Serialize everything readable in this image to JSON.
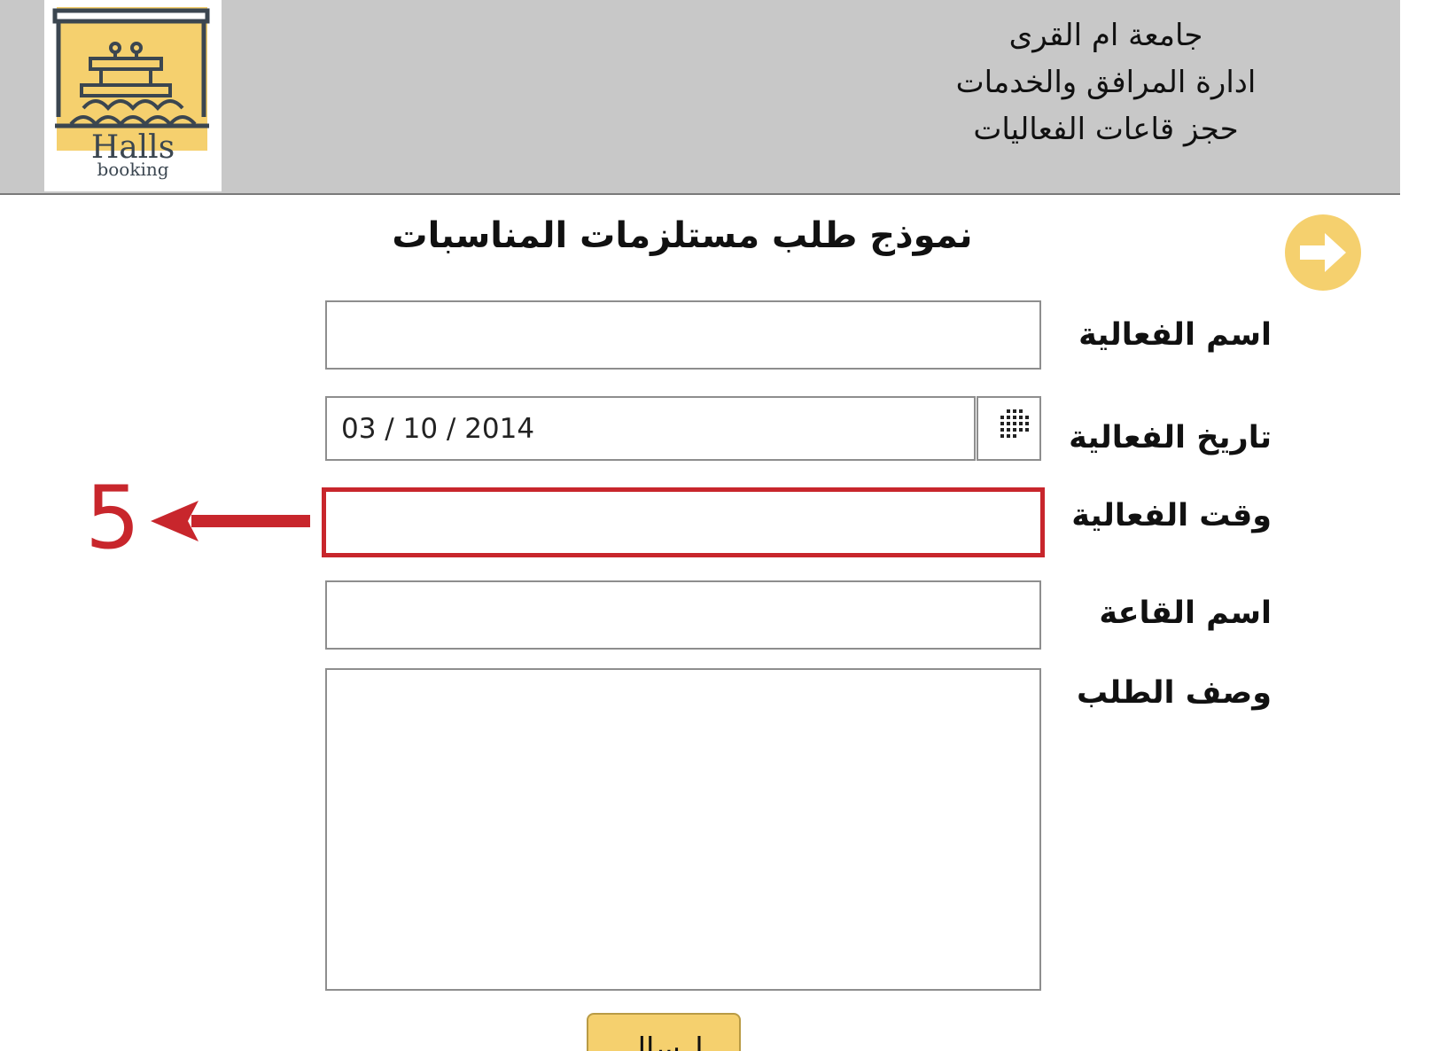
{
  "header": {
    "logo": {
      "title": "Halls",
      "subtitle": "booking",
      "accent_color": "#f5d06e"
    },
    "org_lines": [
      "جامعة ام القرى",
      "ادارة المرافق والخدمات",
      "حجز قاعات الفعاليات"
    ]
  },
  "back_button": {
    "icon": "arrow-right-icon",
    "color": "#f5d06e"
  },
  "form": {
    "title": "نموذج طلب مستلزمات المناسبات",
    "fields": {
      "event_name": {
        "label": "اسم الفعالية",
        "value": ""
      },
      "event_date": {
        "label": "تاريخ الفعالية",
        "value": "03 / 10 / 2014",
        "picker_icon": "calendar-grid-icon"
      },
      "event_time": {
        "label": "وقت الفعالية",
        "value": "",
        "highlight_color": "#c8262c"
      },
      "hall_name": {
        "label": "اسم القاعة",
        "value": ""
      },
      "request_description": {
        "label": "وصف الطلب",
        "value": ""
      }
    },
    "submit_label": "ارسال"
  },
  "annotation": {
    "number": "5",
    "color": "#c8262c",
    "points_to": "event_time"
  }
}
